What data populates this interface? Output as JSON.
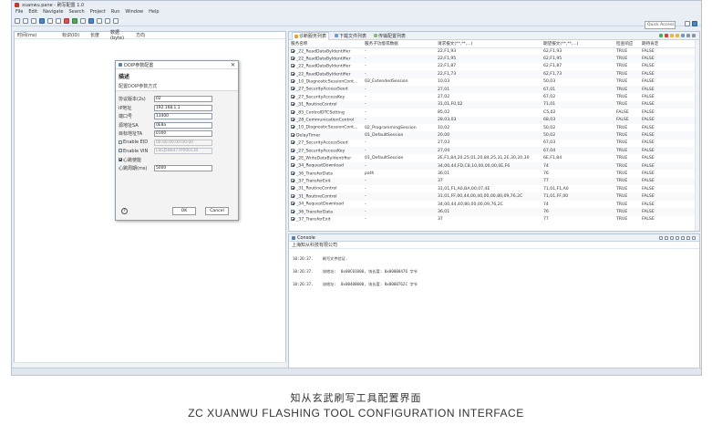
{
  "window": {
    "title": "xuanwu.pane - 刷写配置 1.0"
  },
  "menu": [
    "File",
    "Edit",
    "Navigate",
    "Search",
    "Project",
    "Run",
    "Window",
    "Help"
  ],
  "quick_access": "Quick Access",
  "left_panel": {
    "columns": [
      "时间(ms)",
      "标识(ID)",
      "长度",
      "数据(byte)",
      "方向"
    ]
  },
  "tabs": [
    "诊断服务列表",
    "下载文件列表",
    "传输配置列表"
  ],
  "table": {
    "columns": [
      "服务名称",
      "服务子功能或数据",
      "请求报文(**,**,...)",
      "期望报文(**,**,...)",
      "检查响应",
      "期待肯定"
    ],
    "rows": [
      [
        "_22_ReadDataByIdentifier",
        "-",
        "22,F1,93",
        "62,F1,93",
        "TRUE",
        "FALSE"
      ],
      [
        "_22_ReadDataByIdentifier",
        "-",
        "22,F1,95",
        "62,F1,95",
        "TRUE",
        "FALSE"
      ],
      [
        "_22_ReadDataByIdentifier",
        "-",
        "22,F1,87",
        "62,F1,87",
        "TRUE",
        "FALSE"
      ],
      [
        "_22_ReadDataByIdentifier",
        "-",
        "22,F1,73",
        "62,F1,73",
        "TRUE",
        "FALSE"
      ],
      [
        "_10_DiagnosticSessionCont...",
        "03_ExtendedSession",
        "10,03",
        "50,03",
        "TRUE",
        "FALSE"
      ],
      [
        "_27_SecurityAccessSeed",
        "-",
        "27,01",
        "67,01",
        "TRUE",
        "FALSE"
      ],
      [
        "_27_SecurityAccessKey",
        "-",
        "27,02",
        "67,02",
        "TRUE",
        "FALSE"
      ],
      [
        "_31_RoutineControl",
        "-",
        "31,01,F0,02",
        "71,01",
        "TRUE",
        "FALSE"
      ],
      [
        "_85_ControlDTCSetting",
        "-",
        "85,02",
        "C5,02",
        "FALSE",
        "FALSE"
      ],
      [
        "_28_CommunicationControl",
        "-",
        "28,03,03",
        "68,03",
        "FALSE",
        "FALSE"
      ],
      [
        "_10_DiagnosticSessionCont...",
        "02_ProgrammingSession",
        "10,02",
        "50,02",
        "TRUE",
        "FALSE"
      ],
      [
        "DelayTimer",
        "01_DefaultSession",
        "20,00",
        "50,02",
        "TRUE",
        "FALSE"
      ],
      [
        "_27_SecurityAccessSeed",
        "-",
        "27,03",
        "67,03",
        "TRUE",
        "FALSE"
      ],
      [
        "_27_SecurityAccessKey",
        "-",
        "27,04",
        "67,04",
        "TRUE",
        "FALSE"
      ],
      [
        "_2E_WriteDataByIdentifier",
        "01_DefaultSession",
        "2E,F1,84,20,25,01,20,84,25,31,2E,30,20,30",
        "6E,F1,84",
        "TRUE",
        "FALSE"
      ],
      [
        "_34_RequestDownload",
        "-",
        "34,00,44,FD,C8,10,00,00,00,0E,F6",
        "74",
        "TRUE",
        "FALSE"
      ],
      [
        "_36_TransferData",
        "path",
        "36,01",
        "76",
        "TRUE",
        "FALSE"
      ],
      [
        "_37_TransferExit",
        "-",
        "37",
        "77",
        "TRUE",
        "FALSE"
      ],
      [
        "_31_RoutineControl",
        "-",
        "31,01,F1,A0,BA,00,07,4E",
        "71,01,F1,A0",
        "TRUE",
        "FALSE"
      ],
      [
        "_31_RoutineControl",
        "-",
        "31,01,FF,00,44,00,40,00,00,80,09,76,2C",
        "71,01,FF,00",
        "TRUE",
        "FALSE"
      ],
      [
        "_34_RequestDownload",
        "-",
        "34,00,44,40,80,00,00,09,76,2C",
        "74",
        "TRUE",
        "FALSE"
      ],
      [
        "_36_TransferData",
        "-",
        "36,01",
        "76",
        "TRUE",
        "FALSE"
      ],
      [
        "_37_TransferExit",
        "-",
        "37",
        "77",
        "TRUE",
        "FALSE"
      ]
    ]
  },
  "console": {
    "title": "Console",
    "subtitle": "上海知从科技有限公司",
    "lines": [
      "10:26:37.    刷写文件验证.",
      "10:26:37.    块地址:  0x00C01000, 块长度: 0x00000476 字节",
      "10:26:37.    块地址:  0x00400000, 块长度: 0x0000762C 字节"
    ]
  },
  "dialog": {
    "title": "DOIP参数配置",
    "heading": "描述",
    "subheading": "配置DOIP参数方式",
    "fields": [
      {
        "label": "协议版本(2s)",
        "value": "02",
        "disabled": false
      },
      {
        "label": "IP地址",
        "value": "192.168.1.1",
        "disabled": false
      },
      {
        "label": "端口号",
        "value": "13400",
        "disabled": false
      },
      {
        "label": "源地址SA",
        "value": "0E8a",
        "disabled": false
      },
      {
        "label": "目标地址TA",
        "value": "0160",
        "disabled": false
      }
    ],
    "checks": [
      {
        "label": "Enable EID",
        "value": "00:00:00:00:00:00",
        "checked": false
      },
      {
        "label": "Enable VIN",
        "value": "LSGJ5B6477P000130",
        "checked": false
      },
      {
        "label": "心跳使能",
        "value": "",
        "checked": true
      },
      {
        "label": "心跳周期(ms)",
        "value": "5000",
        "checked": false,
        "is_field": true
      }
    ],
    "ok": "OK",
    "cancel": "Cancel"
  },
  "caption": {
    "cn": "知从玄武刷写工具配置界面",
    "en": "ZC XUANWU FLASHING TOOL CONFIGURATION INTERFACE"
  }
}
